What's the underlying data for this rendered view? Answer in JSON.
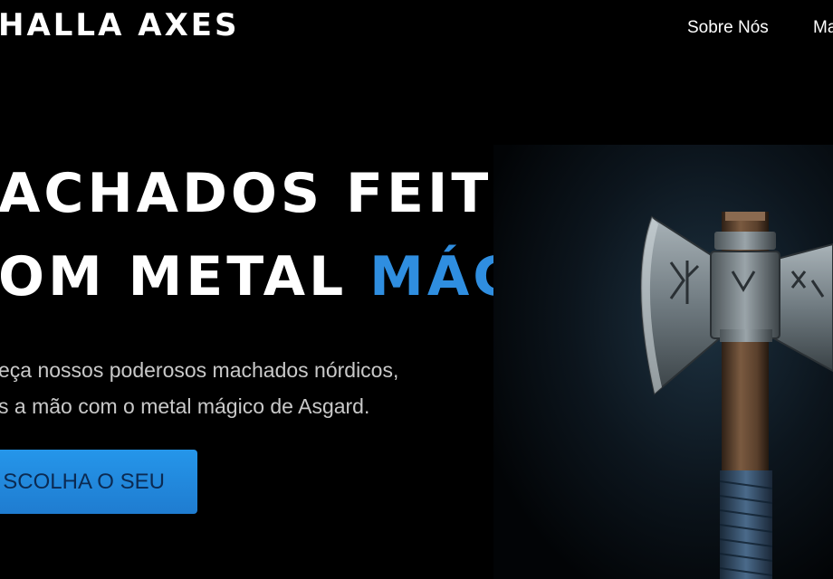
{
  "header": {
    "logo_text": "HALLA AXES",
    "nav": [
      {
        "label": "Sobre Nós"
      },
      {
        "label": "Ma"
      }
    ]
  },
  "hero": {
    "title_line1": "ACHADOS FEITOS",
    "title_line2_prefix": "OM METAL ",
    "title_line2_accent": "MÁGICO",
    "subtitle_line1": "eça nossos poderosos machados nórdicos,",
    "subtitle_line2": "s a mão com o metal mágico de Asgard.",
    "cta_label": "SCOLHA O SEU"
  },
  "colors": {
    "background": "#000000",
    "accent": "#2f8ee0",
    "button": "#1f7cd0"
  },
  "icons": {
    "hero_image": "norse-axe-illustration"
  }
}
